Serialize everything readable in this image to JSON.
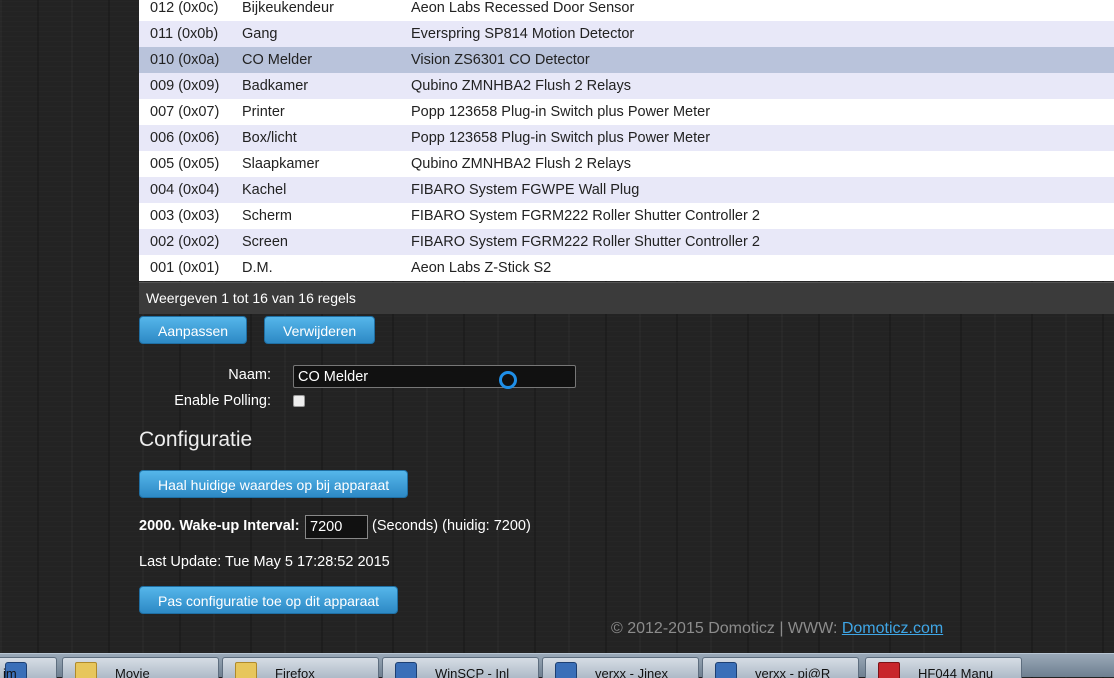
{
  "devices": [
    {
      "id": "012 (0x0c)",
      "name": "Bijkeukendeur",
      "desc": "Aeon Labs Recessed Door Sensor"
    },
    {
      "id": "011 (0x0b)",
      "name": "Gang",
      "desc": "Everspring SP814 Motion Detector"
    },
    {
      "id": "010 (0x0a)",
      "name": "CO Melder",
      "desc": "Vision ZS6301 CO Detector"
    },
    {
      "id": "009 (0x09)",
      "name": "Badkamer",
      "desc": "Qubino ZMNHBA2 Flush 2 Relays"
    },
    {
      "id": "007 (0x07)",
      "name": "Printer",
      "desc": "Popp 123658 Plug-in Switch plus Power Meter"
    },
    {
      "id": "006 (0x06)",
      "name": "Box/licht",
      "desc": "Popp 123658 Plug-in Switch plus Power Meter"
    },
    {
      "id": "005 (0x05)",
      "name": "Slaapkamer",
      "desc": "Qubino ZMNHBA2 Flush 2 Relays"
    },
    {
      "id": "004 (0x04)",
      "name": "Kachel",
      "desc": "FIBARO System FGWPE Wall Plug"
    },
    {
      "id": "003 (0x03)",
      "name": "Scherm",
      "desc": "FIBARO System FGRM222 Roller Shutter Controller 2"
    },
    {
      "id": "002 (0x02)",
      "name": "Screen",
      "desc": "FIBARO System FGRM222 Roller Shutter Controller 2"
    },
    {
      "id": "001 (0x01)",
      "name": "D.M.",
      "desc": "Aeon Labs Z-Stick S2"
    }
  ],
  "table_info": "Weergeven 1 tot 16 van 16 regels",
  "actions": {
    "edit": "Aanpassen",
    "delete": "Verwijderen"
  },
  "form": {
    "name_label": "Naam:",
    "name_value": "CO Melder",
    "polling_label": "Enable Polling:"
  },
  "config": {
    "title": "Configuratie",
    "fetch_button": "Haal huidige waardes op bij apparaat",
    "param_label": "2000. Wake-up Interval:",
    "param_value": "7200",
    "param_suffix": "(Seconds) (huidig: 7200)",
    "last_update": "Last Update: Tue May 5 17:28:52 2015",
    "apply_button": "Pas configuratie toe op dit apparaat"
  },
  "footer": {
    "copyright": "© 2012-2015 Domoticz | WWW: ",
    "link": "Domoticz.com"
  },
  "taskbar": [
    {
      "label": "im",
      "icon": "app-icon"
    },
    {
      "label": "Movie",
      "icon": "folder-icon"
    },
    {
      "label": "Firefox",
      "icon": "folder-icon"
    },
    {
      "label": "WinSCP - Inl",
      "icon": "winscp-icon"
    },
    {
      "label": "verxx - Jinex",
      "icon": "winscp-icon"
    },
    {
      "label": "verxx - pi@R",
      "icon": "winscp-icon"
    },
    {
      "label": "HF044 Manu",
      "icon": "pdf-icon"
    }
  ],
  "colors": {
    "accent": "#2d89c5",
    "selected_row": "#b9c3db",
    "link": "#3fa6e6"
  }
}
